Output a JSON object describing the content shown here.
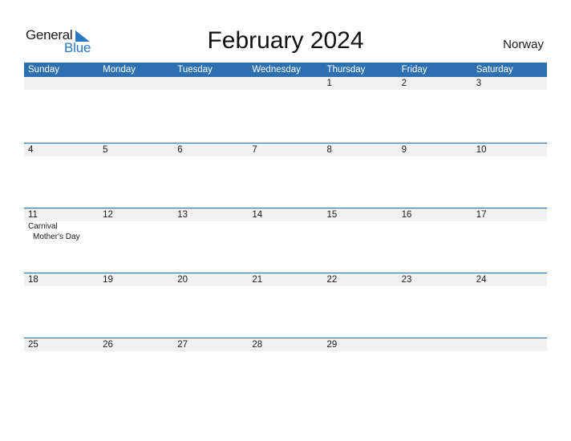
{
  "logo": {
    "word1": "General",
    "word2": "Blue",
    "accent": "#2a78c2"
  },
  "title": "February 2024",
  "country": "Norway",
  "colors": {
    "header_bg": "#2e6fb0",
    "band_bg": "#f1f1f1"
  },
  "weekdays": [
    "Sunday",
    "Monday",
    "Tuesday",
    "Wednesday",
    "Thursday",
    "Friday",
    "Saturday"
  ],
  "weeks": [
    {
      "days": [
        "",
        "",
        "",
        "",
        "1",
        "2",
        "3"
      ],
      "events": [
        [],
        [],
        [],
        [],
        [],
        [],
        []
      ]
    },
    {
      "days": [
        "4",
        "5",
        "6",
        "7",
        "8",
        "9",
        "10"
      ],
      "events": [
        [],
        [],
        [],
        [],
        [],
        [],
        []
      ]
    },
    {
      "days": [
        "11",
        "12",
        "13",
        "14",
        "15",
        "16",
        "17"
      ],
      "events": [
        [
          "Carnival",
          "Mother's Day"
        ],
        [],
        [],
        [],
        [],
        [],
        []
      ]
    },
    {
      "days": [
        "18",
        "19",
        "20",
        "21",
        "22",
        "23",
        "24"
      ],
      "events": [
        [],
        [],
        [],
        [],
        [],
        [],
        []
      ]
    },
    {
      "days": [
        "25",
        "26",
        "27",
        "28",
        "29",
        "",
        ""
      ],
      "events": [
        [],
        [],
        [],
        [],
        [],
        [],
        []
      ]
    }
  ]
}
